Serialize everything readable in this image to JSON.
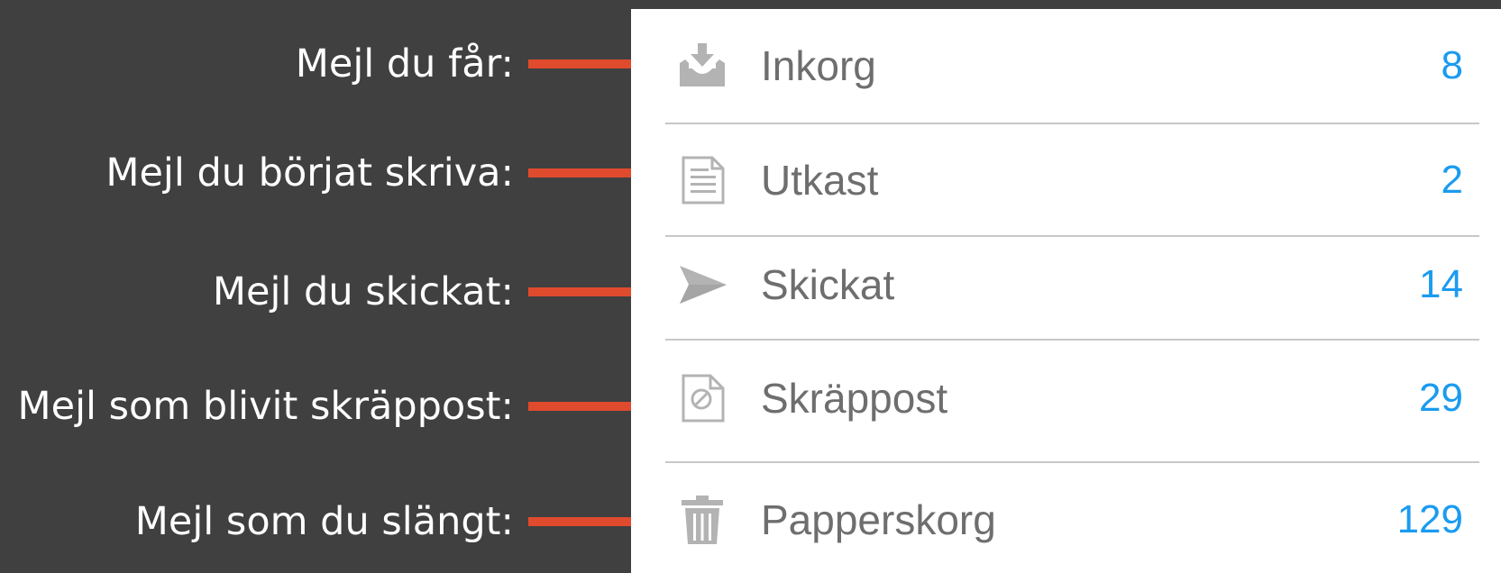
{
  "annotations": [
    {
      "text": "Mejl du får:"
    },
    {
      "text": "Mejl du börjat skriva:"
    },
    {
      "text": "Mejl du skickat:"
    },
    {
      "text": "Mejl som blivit skräppost:"
    },
    {
      "text": "Mejl som du slängt:"
    }
  ],
  "folders": [
    {
      "label": "Inkorg",
      "count": "8",
      "icon": "inbox-icon"
    },
    {
      "label": "Utkast",
      "count": "2",
      "icon": "draft-icon"
    },
    {
      "label": "Skickat",
      "count": "14",
      "icon": "send-icon"
    },
    {
      "label": "Skräppost",
      "count": "29",
      "icon": "spam-icon"
    },
    {
      "label": "Papperskorg",
      "count": "129",
      "icon": "trash-icon"
    }
  ],
  "colors": {
    "background": "#404040",
    "arrow": "#e04a2d",
    "count": "#1a9bf0",
    "label": "#6e6e6e",
    "icon": "#b3b3b3",
    "annotation_text": "#ffffff"
  }
}
